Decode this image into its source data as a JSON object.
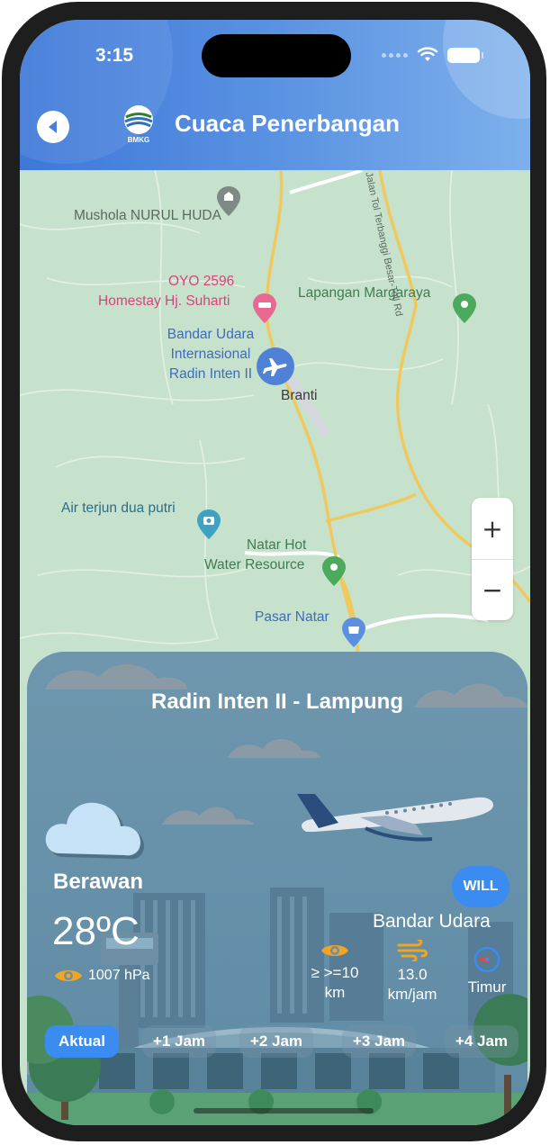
{
  "status_bar": {
    "time": "3:15"
  },
  "header": {
    "title": "Cuaca Penerbangan",
    "logo_text": "BMKG"
  },
  "map": {
    "labels": {
      "mushola": "Mushola NURUL HUDA",
      "oyo_line1": "OYO 2596",
      "oyo_line2": "Homestay Hj. Suharti",
      "airport_line1": "Bandar Udara",
      "airport_line2": "Internasional",
      "airport_line3": "Radin Inten II",
      "lapangan": "Lapangan Margaraya",
      "branti": "Branti",
      "air_terjun": "Air terjun dua putri",
      "natar_line1": "Natar Hot",
      "natar_line2": "Water Resource",
      "pasar": "Pasar Natar",
      "toll_road": "Jalan Tol Terbanggi Besar-Toll Rd"
    },
    "zoom_in": "+",
    "zoom_out": "−"
  },
  "weather": {
    "location": "Radin Inten II - Lampung",
    "condition": "Berawan",
    "temperature": "28ºC",
    "pressure": "1007  hPa",
    "icao": "WILL",
    "station": "Bandar Udara",
    "visibility_line1": "≥ >=10",
    "visibility_line2": "km",
    "wind_line1": "13.0",
    "wind_line2": "km/jam",
    "wind_dir": "Timur",
    "forecast_tabs": [
      "Aktual",
      "+1 Jam",
      "+2 Jam",
      "+3 Jam",
      "+4 Jam"
    ]
  },
  "colors": {
    "header_start": "#3e78d8",
    "header_end": "#7db0ec",
    "accent": "#3a8cf0",
    "card_bg": "#6b90a6",
    "map_bg": "#c7e2cc",
    "icon_orange": "#f0a623"
  }
}
